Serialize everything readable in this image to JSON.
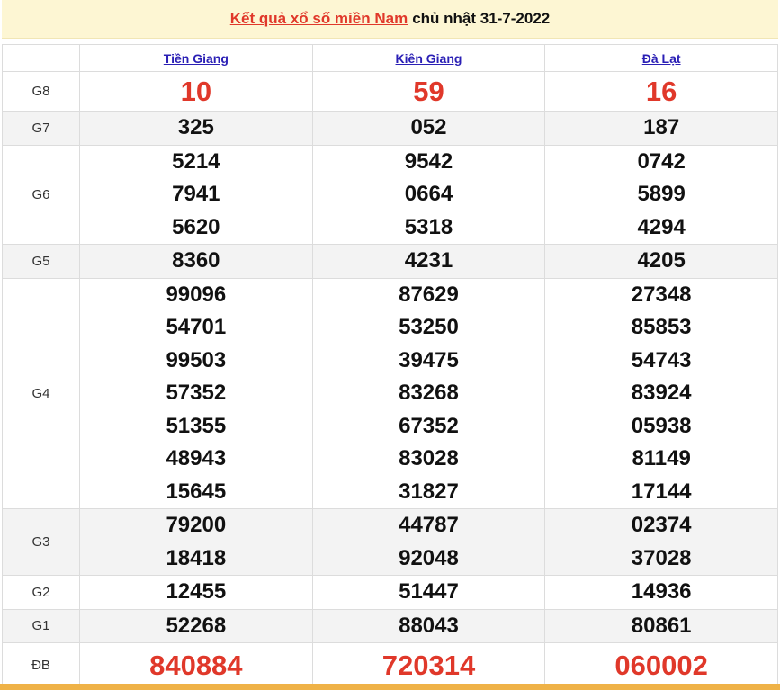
{
  "header": {
    "title_link": "Kết quả xổ số miền Nam",
    "date_text": "chủ nhật 31-7-2022"
  },
  "provinces": [
    "Tiền Giang",
    "Kiên Giang",
    "Đà Lạt"
  ],
  "prizes": [
    {
      "label": "G8",
      "values": [
        [
          "10"
        ],
        [
          "59"
        ],
        [
          "16"
        ]
      ]
    },
    {
      "label": "G7",
      "values": [
        [
          "325"
        ],
        [
          "052"
        ],
        [
          "187"
        ]
      ]
    },
    {
      "label": "G6",
      "values": [
        [
          "5214",
          "7941",
          "5620"
        ],
        [
          "9542",
          "0664",
          "5318"
        ],
        [
          "0742",
          "5899",
          "4294"
        ]
      ]
    },
    {
      "label": "G5",
      "values": [
        [
          "8360"
        ],
        [
          "4231"
        ],
        [
          "4205"
        ]
      ]
    },
    {
      "label": "G4",
      "values": [
        [
          "99096",
          "54701",
          "99503",
          "57352",
          "51355",
          "48943",
          "15645"
        ],
        [
          "87629",
          "53250",
          "39475",
          "83268",
          "67352",
          "83028",
          "31827"
        ],
        [
          "27348",
          "85853",
          "54743",
          "83924",
          "05938",
          "81149",
          "17144"
        ]
      ]
    },
    {
      "label": "G3",
      "values": [
        [
          "79200",
          "18418"
        ],
        [
          "44787",
          "92048"
        ],
        [
          "02374",
          "37028"
        ]
      ]
    },
    {
      "label": "G2",
      "values": [
        [
          "12455"
        ],
        [
          "51447"
        ],
        [
          "14936"
        ]
      ]
    },
    {
      "label": "G1",
      "values": [
        [
          "52268"
        ],
        [
          "88043"
        ],
        [
          "80861"
        ]
      ]
    },
    {
      "label": "ĐB",
      "values": [
        [
          "840884"
        ],
        [
          "720314"
        ],
        [
          "060002"
        ]
      ]
    }
  ],
  "colors": {
    "accent_red": "#e0382a",
    "link_blue": "#2a1fb5",
    "header_bg": "#fdf6d3",
    "bar": "#efb247"
  }
}
